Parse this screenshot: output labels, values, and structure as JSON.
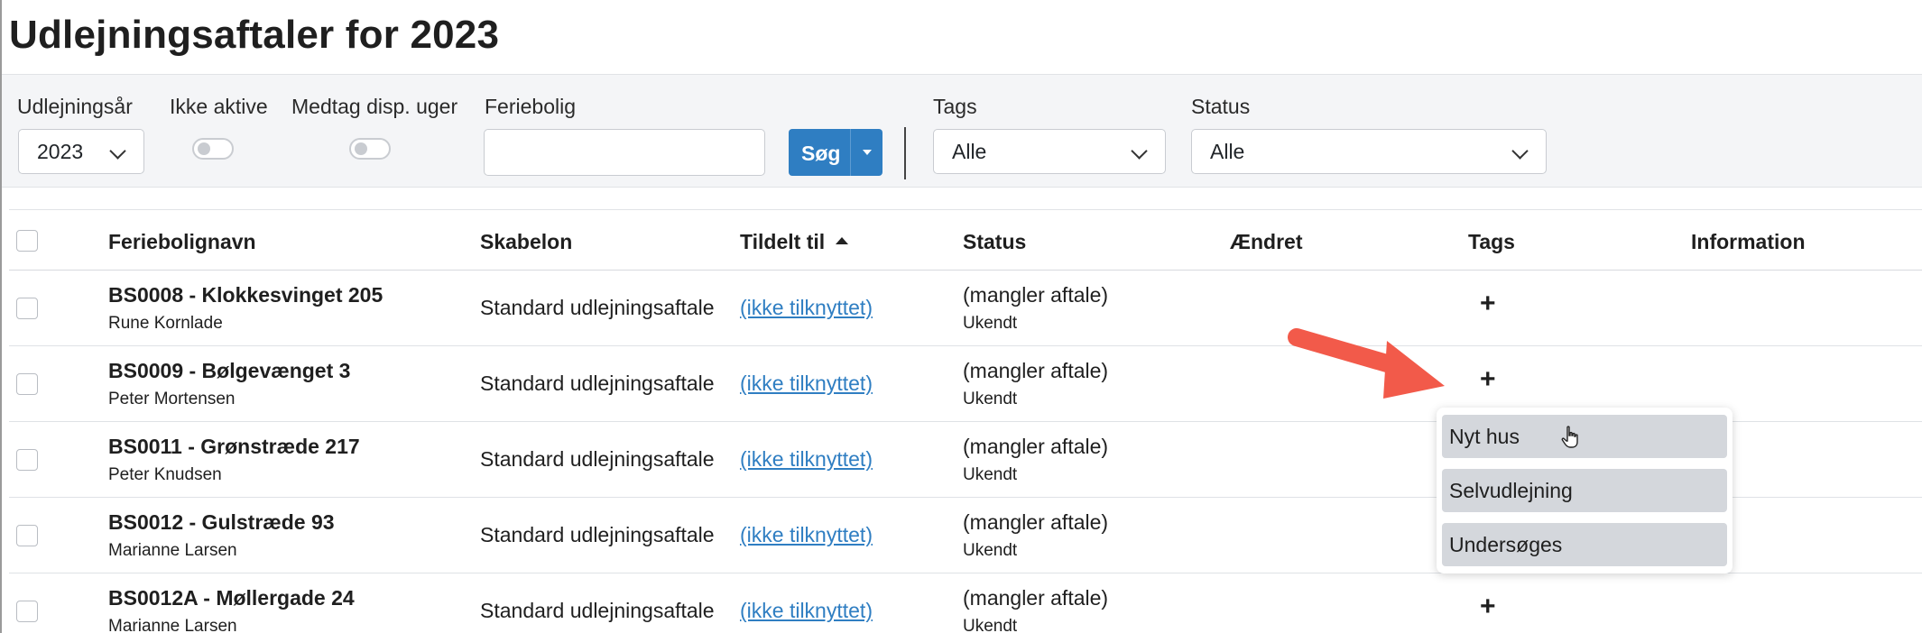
{
  "page": {
    "title": "Udlejningsaftaler for 2023"
  },
  "filters": {
    "year_label": "Udlejningsår",
    "year_value": "2023",
    "inactive_label": "Ikke aktive",
    "include_disp_label": "Medtag disp. uger",
    "property_label": "Feriebolig",
    "property_value": "",
    "search_label": "Søg",
    "tags_label": "Tags",
    "tags_value": "Alle",
    "status_label": "Status",
    "status_value": "Alle"
  },
  "table": {
    "headers": {
      "name": "Feriebolignavn",
      "template": "Skabelon",
      "assigned": "Tildelt til",
      "status": "Status",
      "changed": "Ændret",
      "tags": "Tags",
      "info": "Information"
    },
    "rows": [
      {
        "name": "BS0008 - Klokkesvinget 205",
        "owner": "Rune Kornlade",
        "template": "Standard udlejningsaftale",
        "assigned": "(ikke tilknyttet)",
        "status": "(mangler aftale)",
        "status_sub": "Ukendt",
        "tag_add": "+"
      },
      {
        "name": "BS0009 - Bølgevænget 3",
        "owner": "Peter Mortensen",
        "template": "Standard udlejningsaftale",
        "assigned": "(ikke tilknyttet)",
        "status": "(mangler aftale)",
        "status_sub": "Ukendt",
        "tag_add": "+"
      },
      {
        "name": "BS0011 - Grønstræde 217",
        "owner": "Peter Knudsen",
        "template": "Standard udlejningsaftale",
        "assigned": "(ikke tilknyttet)",
        "status": "(mangler aftale)",
        "status_sub": "Ukendt",
        "tag_add": ""
      },
      {
        "name": "BS0012 - Gulstræde 93",
        "owner": "Marianne Larsen",
        "template": "Standard udlejningsaftale",
        "assigned": "(ikke tilknyttet)",
        "status": "(mangler aftale)",
        "status_sub": "Ukendt",
        "tag_add": ""
      },
      {
        "name": "BS0012A - Møllergade 24",
        "owner": "Marianne Larsen",
        "template": "Standard udlejningsaftale",
        "assigned": "(ikke tilknyttet)",
        "status": "(mangler aftale)",
        "status_sub": "Ukendt",
        "tag_add": "+"
      }
    ]
  },
  "tag_menu": {
    "items": [
      "Nyt hus",
      "Selvudlejning",
      "Undersøges"
    ]
  },
  "colors": {
    "accent": "#2f7ec2",
    "arrow": "#f25a4a",
    "menu_item_bg": "#d4d7dc"
  }
}
